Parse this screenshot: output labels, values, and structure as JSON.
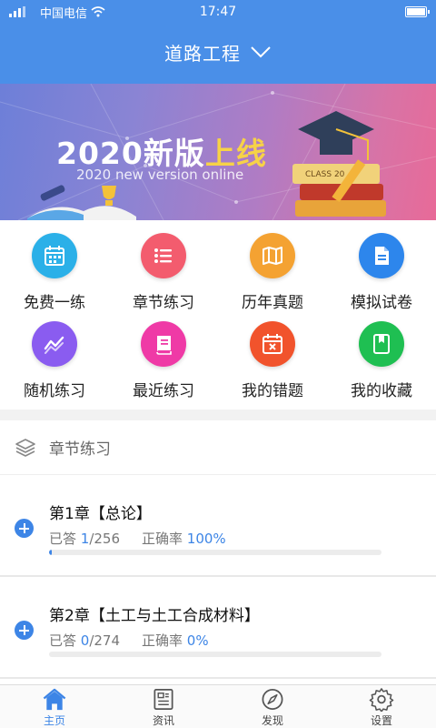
{
  "status": {
    "carrier": "中国电信",
    "time": "17:47"
  },
  "header": {
    "title": "道路工程"
  },
  "banner": {
    "title_main": "2020新版",
    "title_highlight": "上线",
    "subtitle": "2020 new version online"
  },
  "grid": [
    {
      "label": "免费一练",
      "icon": "calendar-icon",
      "color": "#2bb0e8"
    },
    {
      "label": "章节练习",
      "icon": "list-icon",
      "color": "#f35c6e"
    },
    {
      "label": "历年真题",
      "icon": "map-icon",
      "color": "#f4a232"
    },
    {
      "label": "模拟试卷",
      "icon": "document-icon",
      "color": "#2d86ec"
    },
    {
      "label": "随机练习",
      "icon": "trend-icon",
      "color": "#8a5cf0"
    },
    {
      "label": "最近练习",
      "icon": "book-icon",
      "color": "#ef3aa6"
    },
    {
      "label": "我的错题",
      "icon": "wrong-calendar-icon",
      "color": "#f1532c"
    },
    {
      "label": "我的收藏",
      "icon": "bookmark-icon",
      "color": "#1fbf52"
    }
  ],
  "section": {
    "title": "章节练习"
  },
  "chapters": [
    {
      "title": "第1章【总论】",
      "answered_label": "已答 ",
      "answered": "1",
      "total": "/256",
      "accuracy_label": "正确率 ",
      "accuracy": "100%",
      "progress": 0.0039
    },
    {
      "title": "第2章【土工与土工合成材料】",
      "answered_label": "已答 ",
      "answered": "0",
      "total": "/274",
      "accuracy_label": "正确率 ",
      "accuracy": "0%",
      "progress": 0
    }
  ],
  "nav": [
    {
      "label": "主页",
      "icon": "home-icon",
      "active": true
    },
    {
      "label": "资讯",
      "icon": "news-icon",
      "active": false
    },
    {
      "label": "发现",
      "icon": "compass-icon",
      "active": false
    },
    {
      "label": "设置",
      "icon": "gear-icon",
      "active": false
    }
  ]
}
